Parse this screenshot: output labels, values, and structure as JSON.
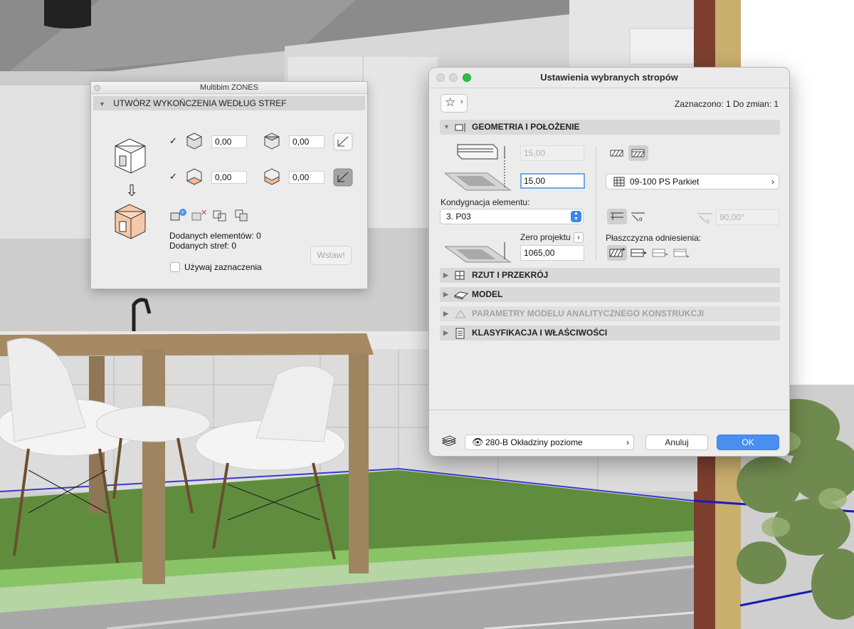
{
  "palette": {
    "title": "Multibim ZONES",
    "section_title": "UTWÓRZ WYKOŃCZENIA WEDŁUG STREF",
    "row1": {
      "checked": true,
      "value_a": "0,00",
      "value_b": "0,00"
    },
    "row2": {
      "checked": true,
      "value_a": "0,00",
      "value_b": "0,00"
    },
    "added_elements": "Dodanych elementów: 0",
    "added_zones": "Dodanych stref: 0",
    "insert_button": "Wstaw!",
    "use_selection_label": "Używaj zaznaczenia"
  },
  "dialog": {
    "title": "Ustawienia wybranych stropów",
    "selection_info": "Zaznaczono: 1 Do zmian: 1",
    "sections": {
      "geometry": "GEOMETRIA I POŁOŻENIE",
      "plan": "RZUT I PRZEKRÓJ",
      "model": "MODEL",
      "analytical": "PARAMETRY MODELU ANALITYCZNEGO KONSTRUKCJI",
      "classification": "KLASYFIKACJA I WŁAŚCIWOŚCI"
    },
    "geometry": {
      "top_offset": "15,00",
      "thickness": "15,00",
      "story_label": "Kondygnacja elementu:",
      "story_value": "3. P03",
      "zero_label": "Zero projektu",
      "elevation": "1065,00",
      "material": "09-100 PS Parkiet",
      "angle": "90,00°",
      "reference_label": "Płaszczyzna odniesienia:"
    },
    "footer": {
      "layer": "280-B Okładziny poziome",
      "cancel": "Anuluj",
      "ok": "OK"
    },
    "colors": {
      "accent": "#3b86f3",
      "ok_button": "#4a8ff0"
    }
  }
}
